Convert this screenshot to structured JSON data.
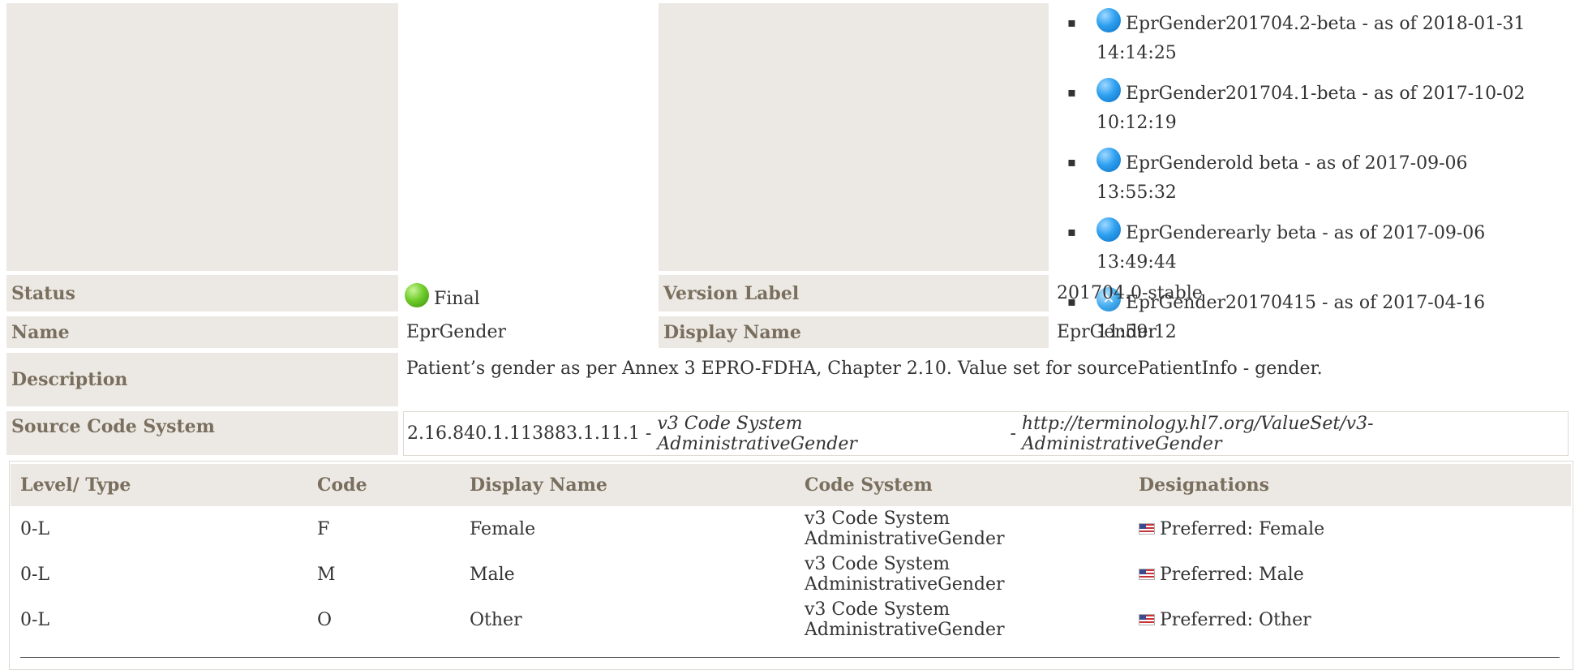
{
  "history": [
    {
      "icon": "blue",
      "text": "EprGender201704.2-beta - as of 2018-01-31 14:14:25"
    },
    {
      "icon": "blue",
      "text": "EprGender201704.1-beta - as of 2017-10-02 10:12:19"
    },
    {
      "icon": "blue",
      "text": "EprGenderold beta - as of 2017-09-06 13:55:32"
    },
    {
      "icon": "blue",
      "text": "EprGenderearly beta - as of 2017-09-06 13:49:44"
    },
    {
      "icon": "cancel",
      "text": "EprGender20170415 - as of 2017-04-16 11:59:12"
    }
  ],
  "props": {
    "status_label": "Status",
    "status_value": "Final",
    "version_label_label": "Version Label",
    "version_label_value": "201704.0-stable",
    "name_label": "Name",
    "name_value": "EprGender",
    "display_name_label": "Display Name",
    "display_name_value": "EprGender",
    "description_label": "Description",
    "description_value": "Patient’s gender as per Annex 3  EPRO-FDHA, Chapter 2.10. Value set for sourcePatientInfo - gender.",
    "source_label": "Source Code System",
    "source_oid": "2.16.840.1.113883.1.11.1",
    "source_sep1": " - ",
    "source_name": "v3 Code System AdministrativeGender",
    "source_sep2": " - ",
    "source_url": "http://terminology.hl7.org/ValueSet/v3-AdministrativeGender"
  },
  "table": {
    "headers": [
      "Level/ Type",
      "Code",
      "Display Name",
      "Code System",
      "Designations"
    ],
    "rows": [
      {
        "level": "0-L",
        "code": "F",
        "display": "Female",
        "system": "v3 Code System AdministrativeGender",
        "designation": "Preferred: Female"
      },
      {
        "level": "0-L",
        "code": "M",
        "display": "Male",
        "system": "v3 Code System AdministrativeGender",
        "designation": "Preferred: Male"
      },
      {
        "level": "0-L",
        "code": "O",
        "display": "Other",
        "system": "v3 Code System AdministrativeGender",
        "designation": "Preferred: Other"
      }
    ]
  },
  "colors": {
    "label_bg": "#ece9e4",
    "label_text": "#7a6f5e",
    "status_final": "#6fcc2a",
    "history_icon": "#2ea0f0"
  }
}
